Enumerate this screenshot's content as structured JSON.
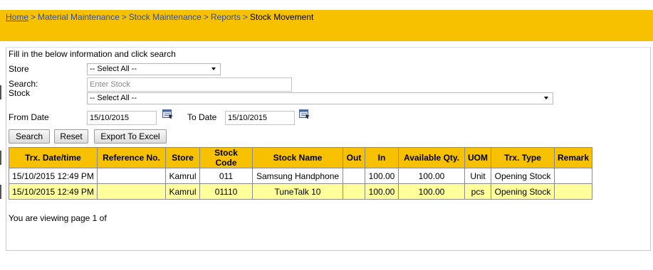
{
  "breadcrumb": {
    "items": [
      "Home",
      "Material Maintenance",
      "Stock Maintenance",
      "Reports"
    ],
    "separator": ">",
    "current": "Stock Movement"
  },
  "form": {
    "instructions": "Fill in the below information and click search",
    "store_label": "Store",
    "store_value": "-- Select All --",
    "search_label": "Search:",
    "search_placeholder": "Enter Stock",
    "stock_label": "Stock",
    "stock_value": "-- Select All --",
    "from_date_label": "From Date",
    "from_date_value": "15/10/2015",
    "to_date_label": "To Date",
    "to_date_value": "15/10/2015"
  },
  "buttons": {
    "search": "Search",
    "reset": "Reset",
    "export": "Export To Excel"
  },
  "table": {
    "columns": [
      "Trx. Date/time",
      "Reference No.",
      "Store",
      "Stock Code",
      "Stock Name",
      "Out",
      "In",
      "Available Qty.",
      "UOM",
      "Trx. Type",
      "Remark"
    ],
    "rows": [
      [
        "15/10/2015 12:49 PM",
        "",
        "Kamrul",
        "011",
        "Samsung Handphone",
        "",
        "100.00",
        "100.00",
        "Unit",
        "Opening Stock",
        ""
      ],
      [
        "15/10/2015 12:49 PM",
        "",
        "Kamrul",
        "01110",
        "TuneTalk 10",
        "",
        "100.00",
        "100.00",
        "pcs",
        "Opening Stock",
        ""
      ]
    ]
  },
  "pager_text": "You are viewing page 1 of",
  "colors": {
    "header_bar": "#f8c100",
    "row_alt": "#ffff9c",
    "link": "#2e4e9c"
  }
}
